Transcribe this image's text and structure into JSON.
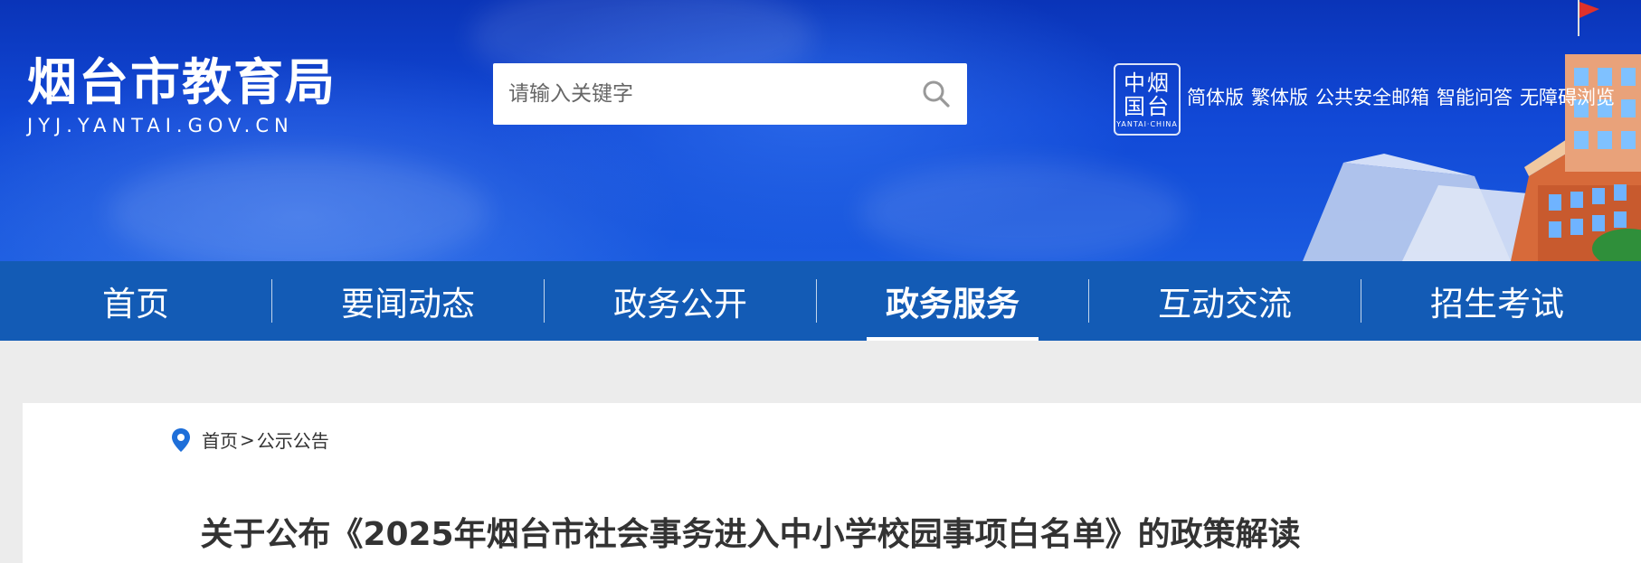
{
  "header": {
    "site_name": "烟台市教育局",
    "site_domain": "JYJ.YANTAI.GOV.CN",
    "search_placeholder": "请输入关键字",
    "seal_glyphs": "中烟国台",
    "seal_caption": "YANTAI·CHINA",
    "top_links": [
      {
        "label": "简体版"
      },
      {
        "label": "繁体版"
      },
      {
        "label": "公共安全邮箱"
      },
      {
        "label": "智能问答"
      },
      {
        "label": "无障碍浏览"
      }
    ]
  },
  "nav": {
    "items": [
      {
        "label": "首页"
      },
      {
        "label": "要闻动态"
      },
      {
        "label": "政务公开"
      },
      {
        "label": "政务服务",
        "active": true
      },
      {
        "label": "互动交流"
      },
      {
        "label": "招生考试"
      }
    ]
  },
  "breadcrumb": {
    "home": "首页",
    "separator": ">",
    "current": "公示公告"
  },
  "article": {
    "title": "关于公布《2025年烟台市社会事务进入中小学校园事项白名单》的政策解读"
  },
  "colors": {
    "nav_bg": "#135bb5",
    "banner_blue": "#1148d6",
    "pin_blue": "#1e6fd9",
    "page_bg": "#ececec"
  }
}
